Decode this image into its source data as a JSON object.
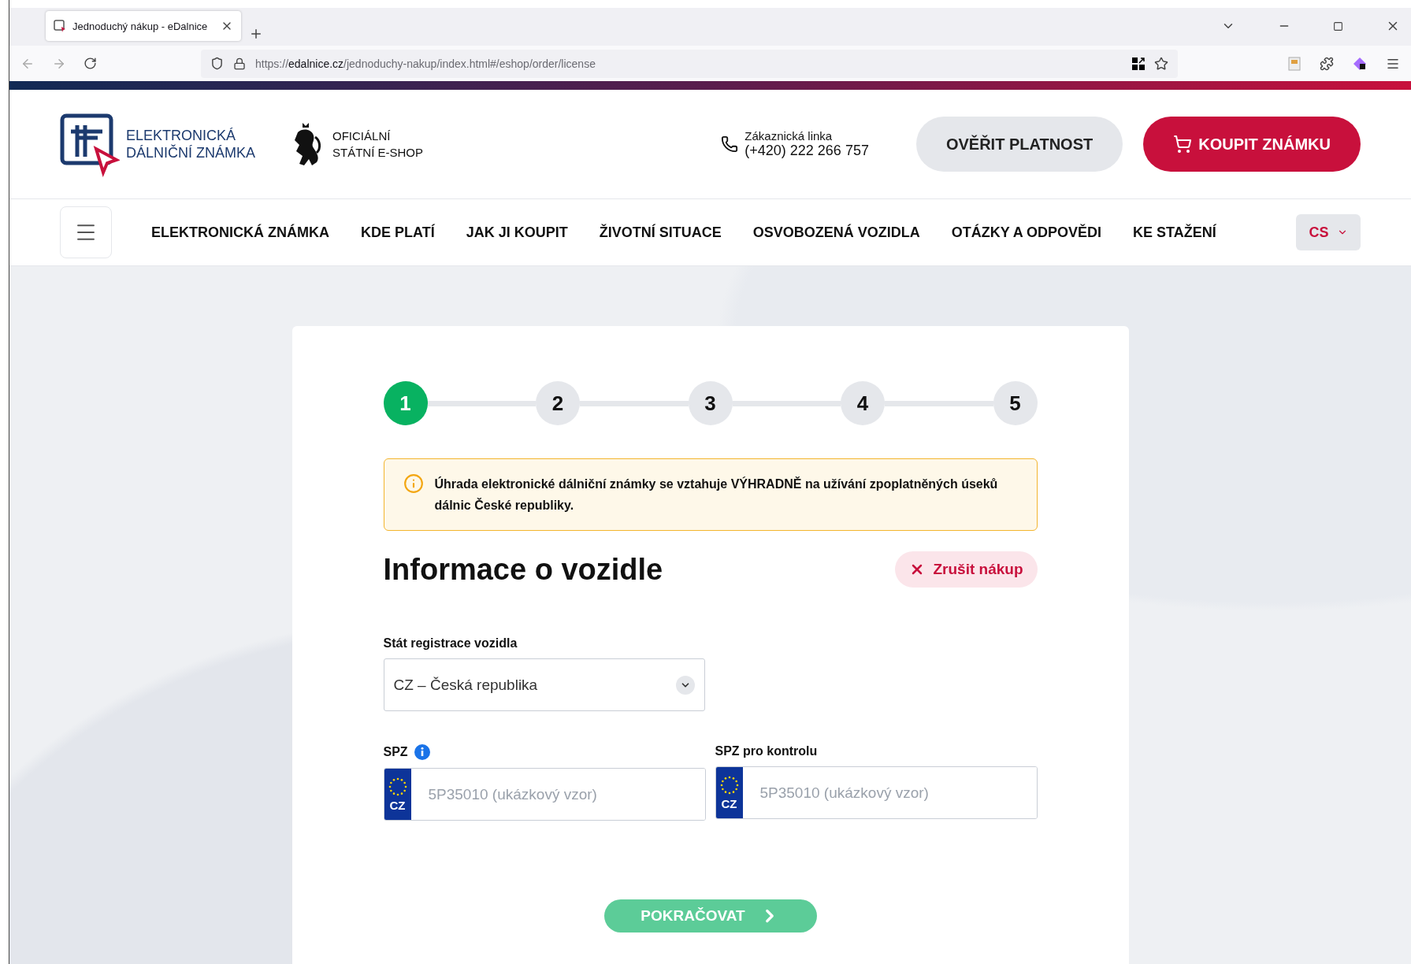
{
  "browser": {
    "tab_title": "Jednoduchý nákup - eDalnice",
    "url": {
      "prefix": "https://",
      "domain": "edalnice.cz",
      "path": "/jednoduchy-nakup/index.html#/eshop/order/license"
    }
  },
  "header": {
    "logo": [
      "ELEKTRONICKÁ",
      "DÁLNIČNÍ ZNÁMKA"
    ],
    "eshop": [
      "OFICIÁLNÍ",
      "STÁTNÍ E-SHOP"
    ],
    "hotline": {
      "label": "Zákaznická linka",
      "phone": "(+420) 222 266 757"
    },
    "buttons": [
      {
        "label": "OVĚŘIT PLATNOST",
        "kind": "secondary"
      },
      {
        "label": "KOUPIT ZNÁMKU",
        "kind": "primary"
      }
    ]
  },
  "nav": {
    "items": [
      "ELEKTRONICKÁ ZNÁMKA",
      "KDE PLATÍ",
      "JAK JI KOUPIT",
      "ŽIVOTNÍ SITUACE",
      "OSVOBOZENÁ VOZIDLA",
      "OTÁZKY A ODPOVĚDI",
      "KE STAŽENÍ"
    ],
    "language": "CS"
  },
  "steps": [
    {
      "label": "1",
      "selected": true
    },
    {
      "label": "2",
      "selected": false
    },
    {
      "label": "3",
      "selected": false
    },
    {
      "label": "4",
      "selected": false
    },
    {
      "label": "5",
      "selected": false
    }
  ],
  "alert": {
    "text": "Úhrada elektronické dálniční známky se vztahuje VÝHRADNĚ na užívání zpoplatněných úseků dálnic České republiky."
  },
  "form": {
    "title": "Informace o vozidle",
    "cancel": "Zrušit nákup",
    "country": {
      "label": "Stát registrace vozidla",
      "value": "CZ – Česká republika"
    },
    "plates": [
      {
        "label": "SPZ",
        "info": true,
        "country_code": "CZ",
        "placeholder": "5P35010 (ukázkový vzor)"
      },
      {
        "label": "SPZ pro kontrolu",
        "info": false,
        "country_code": "CZ",
        "placeholder": "5P35010 (ukázkový vzor)"
      }
    ],
    "submit": {
      "label": "POKRAČOVAT",
      "disabled": true
    }
  }
}
